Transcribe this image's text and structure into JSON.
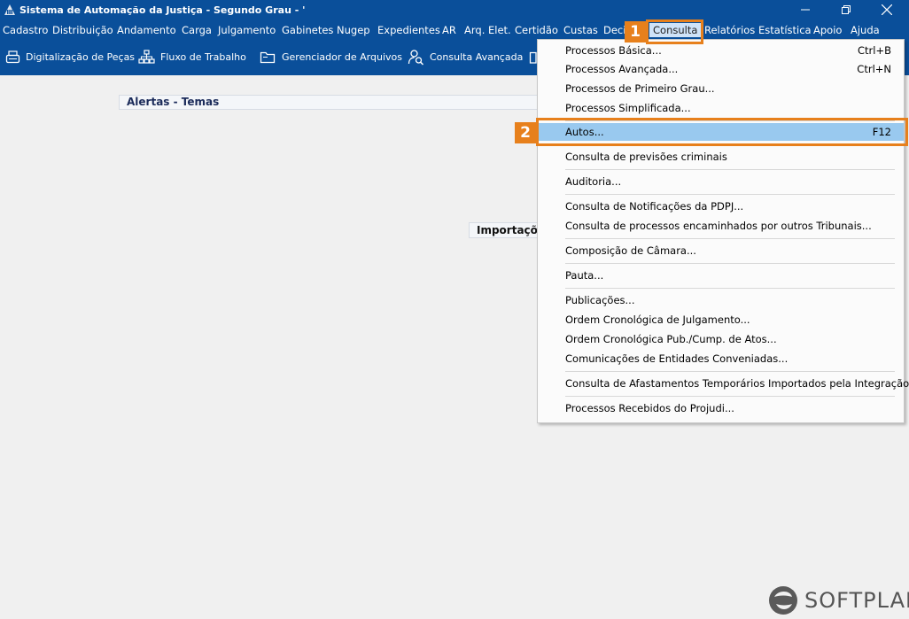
{
  "window": {
    "title": "Sistema de Automação da Justiça - Segundo Grau - '"
  },
  "menubar": {
    "items": [
      {
        "label": "Cadastro"
      },
      {
        "label": "Distribuição"
      },
      {
        "label": "Andamento"
      },
      {
        "label": "Carga"
      },
      {
        "label": "Julgamento"
      },
      {
        "label": "Gabinetes"
      },
      {
        "label": "Nugep"
      },
      {
        "label": "Expedientes"
      },
      {
        "label": "AR"
      },
      {
        "label": "Arq. Elet."
      },
      {
        "label": "Certidão"
      },
      {
        "label": "Custas"
      },
      {
        "label": "Deci"
      },
      {
        "label": "Consulta"
      },
      {
        "label": "Relatórios"
      },
      {
        "label": "Estatística"
      },
      {
        "label": "Apoio"
      },
      {
        "label": "Ajuda"
      }
    ]
  },
  "toolbar": {
    "items": [
      {
        "label": "Digitalização de Peças",
        "icon": "scanner-icon"
      },
      {
        "label": "Fluxo de Trabalho",
        "icon": "workflow-icon"
      },
      {
        "label": "Gerenciador de Arquivos",
        "icon": "folder-icon"
      },
      {
        "label": "Consulta Avançada",
        "icon": "user-search-icon"
      }
    ]
  },
  "content": {
    "alerts_title": "Alertas - Temas",
    "imports_title": "Importações"
  },
  "dropdown": {
    "items": [
      {
        "label": "Processos Básica...",
        "shortcut": "Ctrl+B"
      },
      {
        "label": "Processos Avançada...",
        "shortcut": "Ctrl+N"
      },
      {
        "label": "Processos de Primeiro Grau...",
        "shortcut": ""
      },
      {
        "label": "Processos Simplificada...",
        "shortcut": ""
      },
      {
        "label": "Autos...",
        "shortcut": "F12"
      },
      {
        "label": "Consulta de previsões criminais",
        "shortcut": ""
      },
      {
        "label": "Auditoria...",
        "shortcut": ""
      },
      {
        "label": "Consulta de Notificações da PDPJ...",
        "shortcut": ""
      },
      {
        "label": "Consulta de processos encaminhados por outros Tribunais...",
        "shortcut": ""
      },
      {
        "label": "Composição de Câmara...",
        "shortcut": ""
      },
      {
        "label": "Pauta...",
        "shortcut": ""
      },
      {
        "label": "Publicações...",
        "shortcut": ""
      },
      {
        "label": "Ordem Cronológica de Julgamento...",
        "shortcut": ""
      },
      {
        "label": "Ordem Cronológica Pub./Cump. de Atos...",
        "shortcut": ""
      },
      {
        "label": "Comunicações de Entidades Conveniadas...",
        "shortcut": ""
      },
      {
        "label": "Consulta de Afastamentos Temporários Importados pela Integração",
        "shortcut": ""
      },
      {
        "label": "Processos Recebidos do Projudi...",
        "shortcut": ""
      }
    ]
  },
  "callouts": {
    "step1": "1",
    "step2": "2"
  },
  "brand": {
    "name": "SOFTPLAN"
  },
  "colors": {
    "titlebar": "#0a4f9a",
    "highlight": "#99c9ef",
    "callout": "#e7801c"
  }
}
